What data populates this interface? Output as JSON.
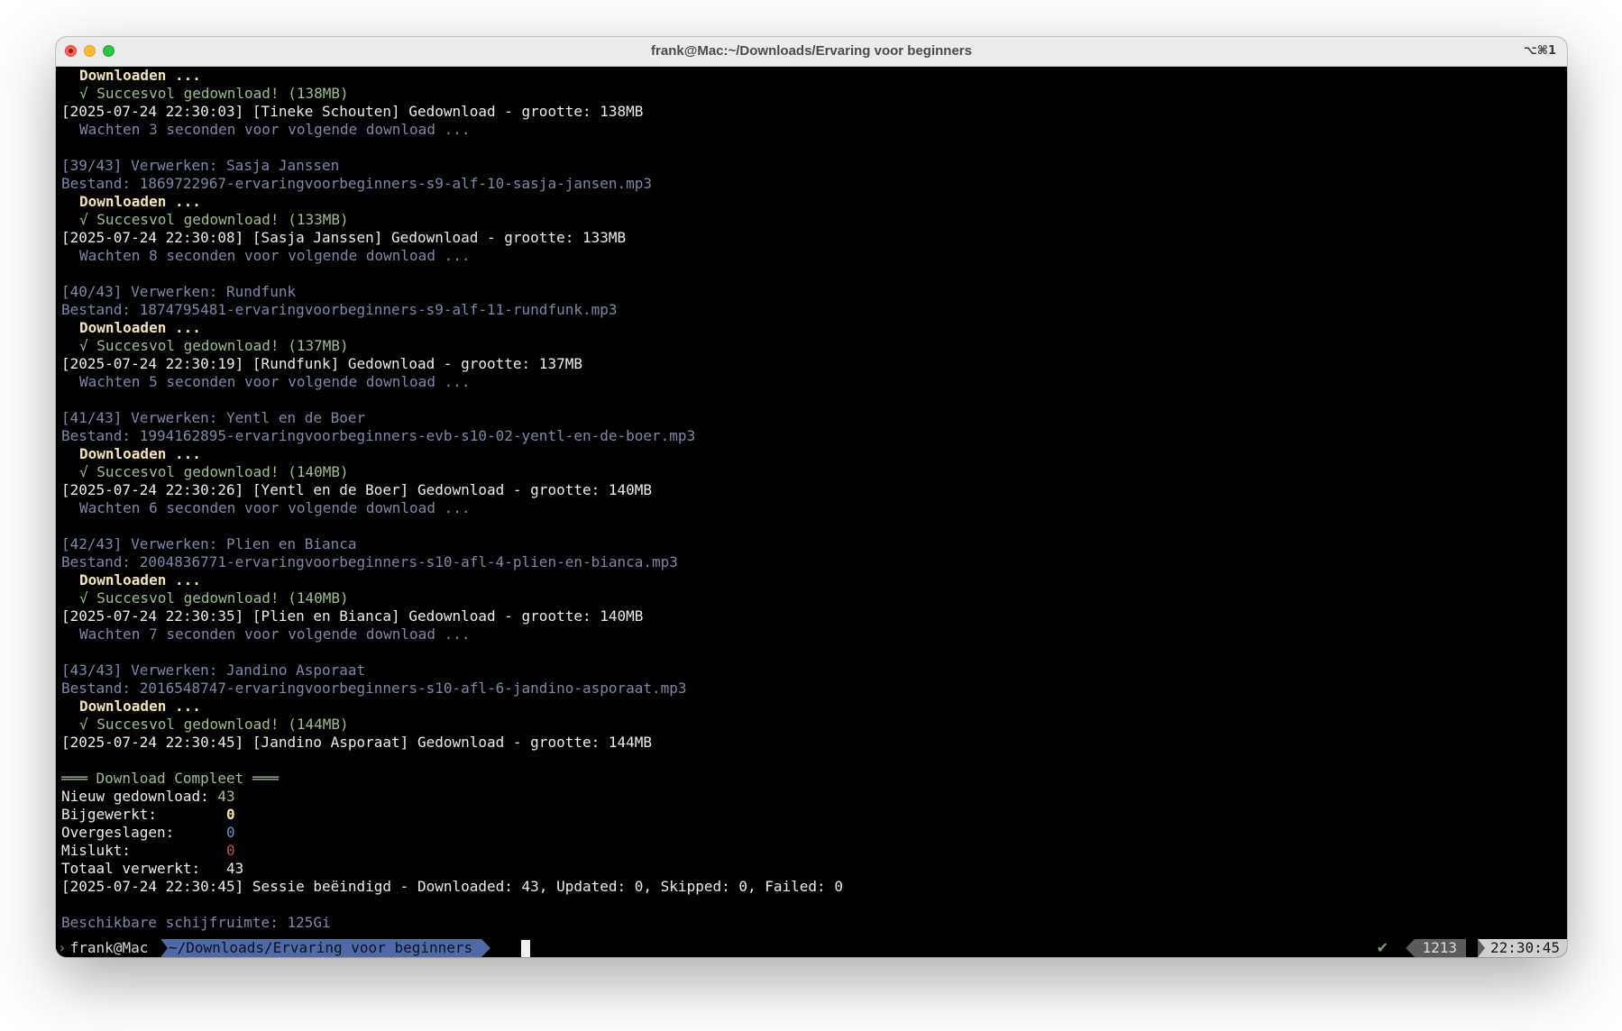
{
  "window": {
    "title": "frank@Mac:~/Downloads/Ervaring voor beginners",
    "shortcut": "⌥⌘1"
  },
  "log": {
    "l01": "Downloaden ...",
    "l02": "√ Succesvol gedownload! (138MB)",
    "l03": "[2025-07-24 22:30:03] [Tineke Schouten] Gedownload - grootte: 138MB",
    "l04": "Wachten 3 seconden voor volgende download ...",
    "l06": "[39/43] Verwerken: Sasja Janssen",
    "l07": "Bestand: 1869722967-ervaringvoorbeginners-s9-alf-10-sasja-jansen.mp3",
    "l08": "Downloaden ...",
    "l09": "√ Succesvol gedownload! (133MB)",
    "l10": "[2025-07-24 22:30:08] [Sasja Janssen] Gedownload - grootte: 133MB",
    "l11": "Wachten 8 seconden voor volgende download ...",
    "l13": "[40/43] Verwerken: Rundfunk",
    "l14": "Bestand: 1874795481-ervaringvoorbeginners-s9-alf-11-rundfunk.mp3",
    "l15": "Downloaden ...",
    "l16": "√ Succesvol gedownload! (137MB)",
    "l17": "[2025-07-24 22:30:19] [Rundfunk] Gedownload - grootte: 137MB",
    "l18": "Wachten 5 seconden voor volgende download ...",
    "l20": "[41/43] Verwerken: Yentl en de Boer",
    "l21": "Bestand: 1994162895-ervaringvoorbeginners-evb-s10-02-yentl-en-de-boer.mp3",
    "l22": "Downloaden ...",
    "l23": "√ Succesvol gedownload! (140MB)",
    "l24": "[2025-07-24 22:30:26] [Yentl en de Boer] Gedownload - grootte: 140MB",
    "l25": "Wachten 6 seconden voor volgende download ...",
    "l27": "[42/43] Verwerken: Plien en Bianca",
    "l28": "Bestand: 2004836771-ervaringvoorbeginners-s10-afl-4-plien-en-bianca.mp3",
    "l29": "Downloaden ...",
    "l30": "√ Succesvol gedownload! (140MB)",
    "l31": "[2025-07-24 22:30:35] [Plien en Bianca] Gedownload - grootte: 140MB",
    "l32": "Wachten 7 seconden voor volgende download ...",
    "l34": "[43/43] Verwerken: Jandino Asporaat",
    "l35": "Bestand: 2016548747-ervaringvoorbeginners-s10-afl-6-jandino-asporaat.mp3",
    "l36": "Downloaden ...",
    "l37": "√ Succesvol gedownload! (144MB)",
    "l38": "[2025-07-24 22:30:45] [Jandino Asporaat] Gedownload - grootte: 144MB"
  },
  "summary": {
    "header": "═══ Download Compleet ═══",
    "new_label": "Nieuw gedownload: ",
    "new_value": "43",
    "updated_label": "Bijgewerkt:        ",
    "updated_value": "0",
    "skipped_label": "Overgeslagen:      ",
    "skipped_value": "0",
    "failed_label": "Mislukt:           ",
    "failed_value": "0",
    "total_label": "Totaal verwerkt:   ",
    "total_value": "43",
    "session": "[2025-07-24 22:30:45] Sessie beëindigd - Downloaded: 43, Updated: 0, Skipped: 0, Failed: 0",
    "disk": "Beschikbare schijfruimte: 125Gi"
  },
  "prompt": {
    "marker": "›",
    "user_host": "frank@Mac",
    "path": "~/Downloads/Ervaring voor beginners",
    "status_check": "✔",
    "history_number": "1213",
    "time": "22:30:45"
  },
  "colors": {
    "terminal_bg": "#000000",
    "dim_text": "#7e88a8",
    "success_green": "#9dbf8a",
    "path_segment": "#4e6ba5"
  }
}
